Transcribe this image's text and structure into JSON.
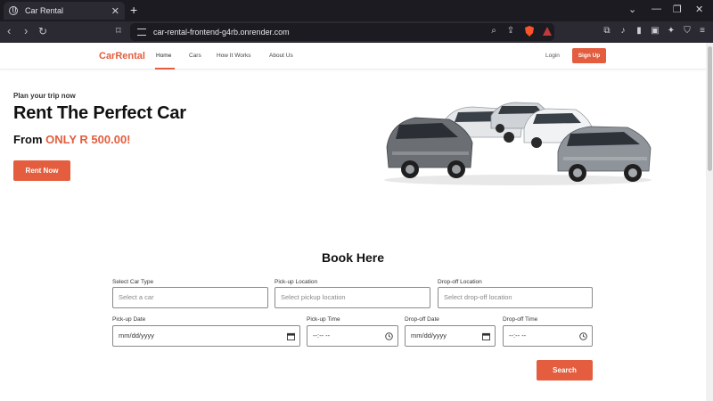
{
  "browser": {
    "tab_title": "Car Rental",
    "url": "car-rental-frontend-g4rb.onrender.com"
  },
  "site": {
    "brand": "CarRental",
    "nav": {
      "home": "Home",
      "cars": "Cars",
      "how": "How It Works",
      "about": "About Us"
    },
    "login": "Login",
    "signup": "Sign Up"
  },
  "hero": {
    "eyebrow": "Plan your trip now",
    "title": "Rent The Perfect Car",
    "from": "From ",
    "price": "ONLY R 500.00!",
    "cta": "Rent Now"
  },
  "booking": {
    "heading": "Book Here",
    "car_type_label": "Select Car Type",
    "car_type_placeholder": "Select a car",
    "pickup_location_label": "Pick-up Location",
    "pickup_location_placeholder": "Select pickup location",
    "dropoff_location_label": "Drop-off Location",
    "dropoff_location_placeholder": "Select drop-off location",
    "pickup_date_label": "Pick-up Date",
    "pickup_date_value": "mm/dd/yyyy",
    "pickup_time_label": "Pick-up Time",
    "pickup_time_value": "--:-- --",
    "dropoff_date_label": "Drop-off Date",
    "dropoff_date_value": "mm/dd/yyyy",
    "dropoff_time_label": "Drop-off Time",
    "dropoff_time_value": "--:-- --",
    "search": "Search"
  },
  "colors": {
    "accent": "#e35d3e"
  }
}
